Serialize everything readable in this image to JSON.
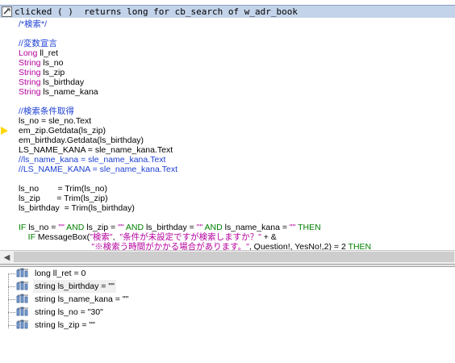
{
  "title": "clicked ( )  returns long for cb_search of w_adr_book",
  "marker_line": 11,
  "code_lines": [
    [
      {
        "t": "/*検索*/",
        "c": "cmt"
      }
    ],
    [],
    [
      {
        "t": "//変数宣言",
        "c": "cmt"
      }
    ],
    [
      {
        "t": "Long",
        "c": "typ"
      },
      {
        "t": " ll_ret",
        "c": ""
      }
    ],
    [
      {
        "t": "String",
        "c": "typ"
      },
      {
        "t": " ls_no",
        "c": ""
      }
    ],
    [
      {
        "t": "String",
        "c": "typ"
      },
      {
        "t": " ls_zip",
        "c": ""
      }
    ],
    [
      {
        "t": "String",
        "c": "typ"
      },
      {
        "t": " ls_birthday",
        "c": ""
      }
    ],
    [
      {
        "t": "String",
        "c": "typ"
      },
      {
        "t": " ls_name_kana",
        "c": ""
      }
    ],
    [],
    [
      {
        "t": "//検索条件取得",
        "c": "cmt"
      }
    ],
    [
      {
        "t": "ls_no = sle_no.Text",
        "c": ""
      }
    ],
    [
      {
        "t": "em_zip.Getdata(ls_zip)",
        "c": ""
      }
    ],
    [
      {
        "t": "em_birthday.Getdata(ls_birthday)",
        "c": ""
      }
    ],
    [
      {
        "t": "LS_NAME_KANA = sle_name_kana.Text",
        "c": ""
      }
    ],
    [
      {
        "t": "//ls_name_kana = sle_name_kana.Text",
        "c": "cmt"
      }
    ],
    [
      {
        "t": "//LS_NAME_KANA = sle_name_kana.Text",
        "c": "cmt"
      }
    ],
    [],
    [
      {
        "t": "ls_no        = Trim(ls_no)",
        "c": ""
      }
    ],
    [
      {
        "t": "ls_zip       = Trim(ls_zip)",
        "c": ""
      }
    ],
    [
      {
        "t": "ls_birthday  = Trim(ls_birthday)",
        "c": ""
      }
    ],
    [],
    [
      {
        "t": "IF",
        "c": "grn"
      },
      {
        "t": " ls_no = ",
        "c": ""
      },
      {
        "t": "\"\"",
        "c": "str"
      },
      {
        "t": " AND",
        "c": "grn"
      },
      {
        "t": " ls_zip = ",
        "c": ""
      },
      {
        "t": "\"\"",
        "c": "str"
      },
      {
        "t": " AND",
        "c": "grn"
      },
      {
        "t": " ls_birthday = ",
        "c": ""
      },
      {
        "t": "\"\"",
        "c": "str"
      },
      {
        "t": " AND",
        "c": "grn"
      },
      {
        "t": " ls_name_kana = ",
        "c": ""
      },
      {
        "t": "\"\"",
        "c": "str"
      },
      {
        "t": " THEN",
        "c": "grn"
      }
    ],
    [
      {
        "t": "    IF",
        "c": "grn"
      },
      {
        "t": " MessageBox(",
        "c": ""
      },
      {
        "t": "\"検索\"",
        "c": "str"
      },
      {
        "t": ",  ",
        "c": ""
      },
      {
        "t": "\"条件が未設定ですが検索しますか？\"",
        "c": "str"
      },
      {
        "t": " + &",
        "c": ""
      }
    ],
    [
      {
        "t": "                               \"※検索う時間がかかる場合があります。\"",
        "c": "str"
      },
      {
        "t": ", Question!, YesNo!,2) = 2 ",
        "c": ""
      },
      {
        "t": "THEN",
        "c": "grn"
      }
    ]
  ],
  "variables": [
    {
      "label": "long ll_ret = 0",
      "selected": false
    },
    {
      "label": "string ls_birthday = \"\"",
      "selected": true
    },
    {
      "label": "string ls_name_kana = \"\"",
      "selected": false
    },
    {
      "label": "string ls_no = \"30\"",
      "selected": false
    },
    {
      "label": "string ls_zip = \"\"",
      "selected": false
    }
  ]
}
